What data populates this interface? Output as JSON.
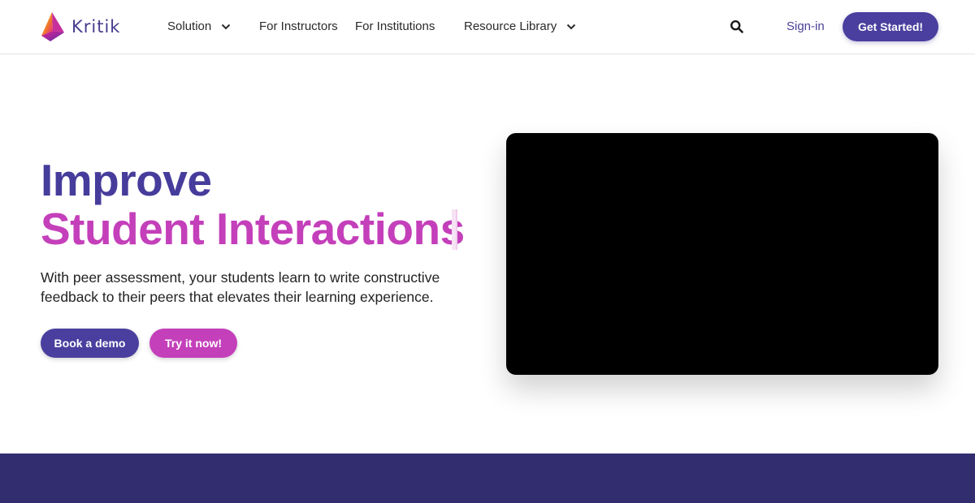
{
  "brand": {
    "name": "Kritik",
    "colors": {
      "primary": "#4a3f9e",
      "accent": "#c43fba",
      "footer": "#312d6e"
    }
  },
  "nav": {
    "solution": "Solution",
    "instructors": "For Instructors",
    "institutions": "For Institutions",
    "resources": "Resource Library",
    "signin": "Sign-in",
    "get_started": "Get Started!"
  },
  "icons": {
    "search": "search-icon",
    "chevron": "chevron-down-icon",
    "logo": "kritik-logo-icon"
  },
  "hero": {
    "title_line1": "Improve",
    "title_line2": "Student Interactions",
    "description": "With peer assessment, your students learn to write constructive feedback to their peers that elevates their learning experience.",
    "book_demo": "Book a demo",
    "try_now": "Try it now!"
  }
}
